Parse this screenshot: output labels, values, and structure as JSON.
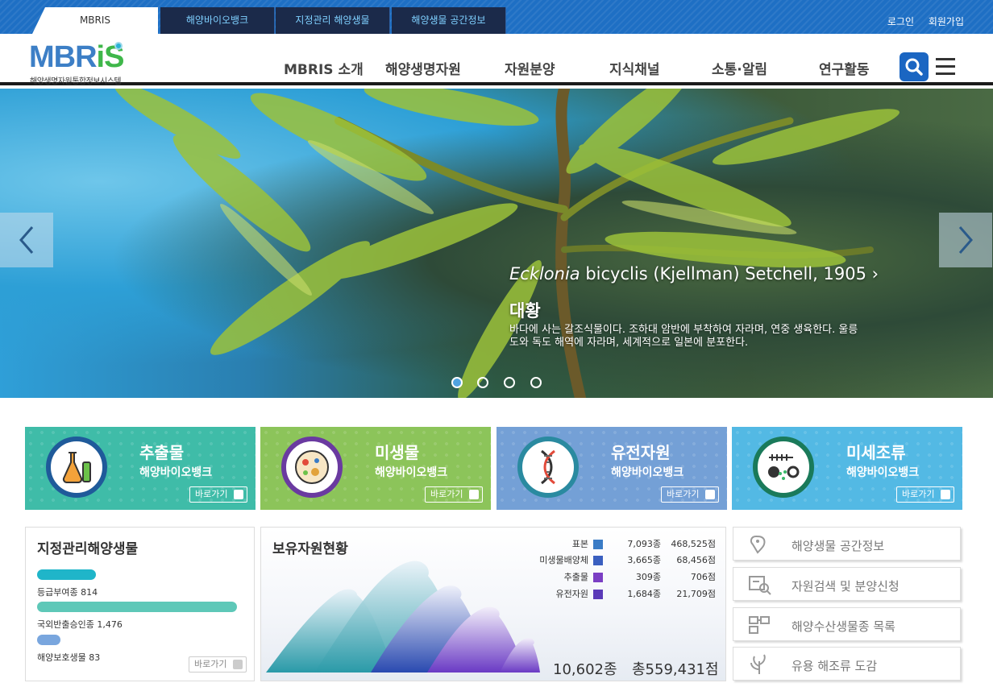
{
  "top_tabs": [
    "MBRIS",
    "해양바이오뱅크",
    "지정관리 해양생물",
    "해양생물 공간정보"
  ],
  "top_links": {
    "login": "로그인",
    "signup": "회원가입"
  },
  "logo": {
    "word_m": "MBR",
    "word_i": "i",
    "word_s": "S",
    "subtitle": "해양생명자원통합정보시스템"
  },
  "nav": [
    "MBRIS 소개",
    "해양생명자원",
    "자원분양",
    "지식채널",
    "소통·알림",
    "연구활동"
  ],
  "hero": {
    "genus": "Ecklonia",
    "scientific_rest": " bicyclis (Kjellman) Setchell, 1905",
    "chevron": "›",
    "name": "대황",
    "description": "바다에 사는 갈조식물이다. 조하대 암반에 부착하여 자라며, 연중 생육한다. 울릉도와 독도 해역에 자라며, 세계적으로 일본에 분포한다.",
    "active_slide": 1,
    "slide_count": 4
  },
  "cards": [
    {
      "title": "추출물",
      "sub": "해양바이오뱅크",
      "go": "바로가기",
      "icon": "flask-icon"
    },
    {
      "title": "미생물",
      "sub": "해양바이오뱅크",
      "go": "바로가기",
      "icon": "petri-dish-icon"
    },
    {
      "title": "유전자원",
      "sub": "해양바이오뱅크",
      "go": "바로가기",
      "icon": "dna-icon"
    },
    {
      "title": "미세조류",
      "sub": "해양바이오뱅크",
      "go": "바로가기",
      "icon": "microalgae-icon"
    }
  ],
  "managed": {
    "title": "지정관리해양생물",
    "items": [
      {
        "label": "등급부여종 814",
        "value": 814
      },
      {
        "label": "국외반출승인종 1,476",
        "value": 1476
      },
      {
        "label": "해양보호생물 83",
        "value": 83
      }
    ],
    "go": "바로가기"
  },
  "holdings": {
    "title": "보유자원현황",
    "rows": [
      {
        "name": "표본",
        "species": "7,093종",
        "items": "468,525점",
        "color": "#3a7cc6"
      },
      {
        "name": "미생물배양체",
        "species": "3,665종",
        "items": "68,456점",
        "color": "#3a5fc0"
      },
      {
        "name": "추출물",
        "species": "309종",
        "items": "706점",
        "color": "#7b3fc4"
      },
      {
        "name": "유전자원",
        "species": "1,684종",
        "items": "21,709점",
        "color": "#5a3ab8"
      }
    ],
    "total_species": "10,602종",
    "total_items": "총559,431점"
  },
  "quick_links": [
    {
      "label": "해양생물 공간정보",
      "icon": "map-pin-icon"
    },
    {
      "label": "자원검색 및 분양신청",
      "icon": "search-document-icon"
    },
    {
      "label": "해양수산생물종 목록",
      "icon": "hierarchy-icon"
    },
    {
      "label": "유용 해조류 도감",
      "icon": "seaweed-icon"
    }
  ]
}
